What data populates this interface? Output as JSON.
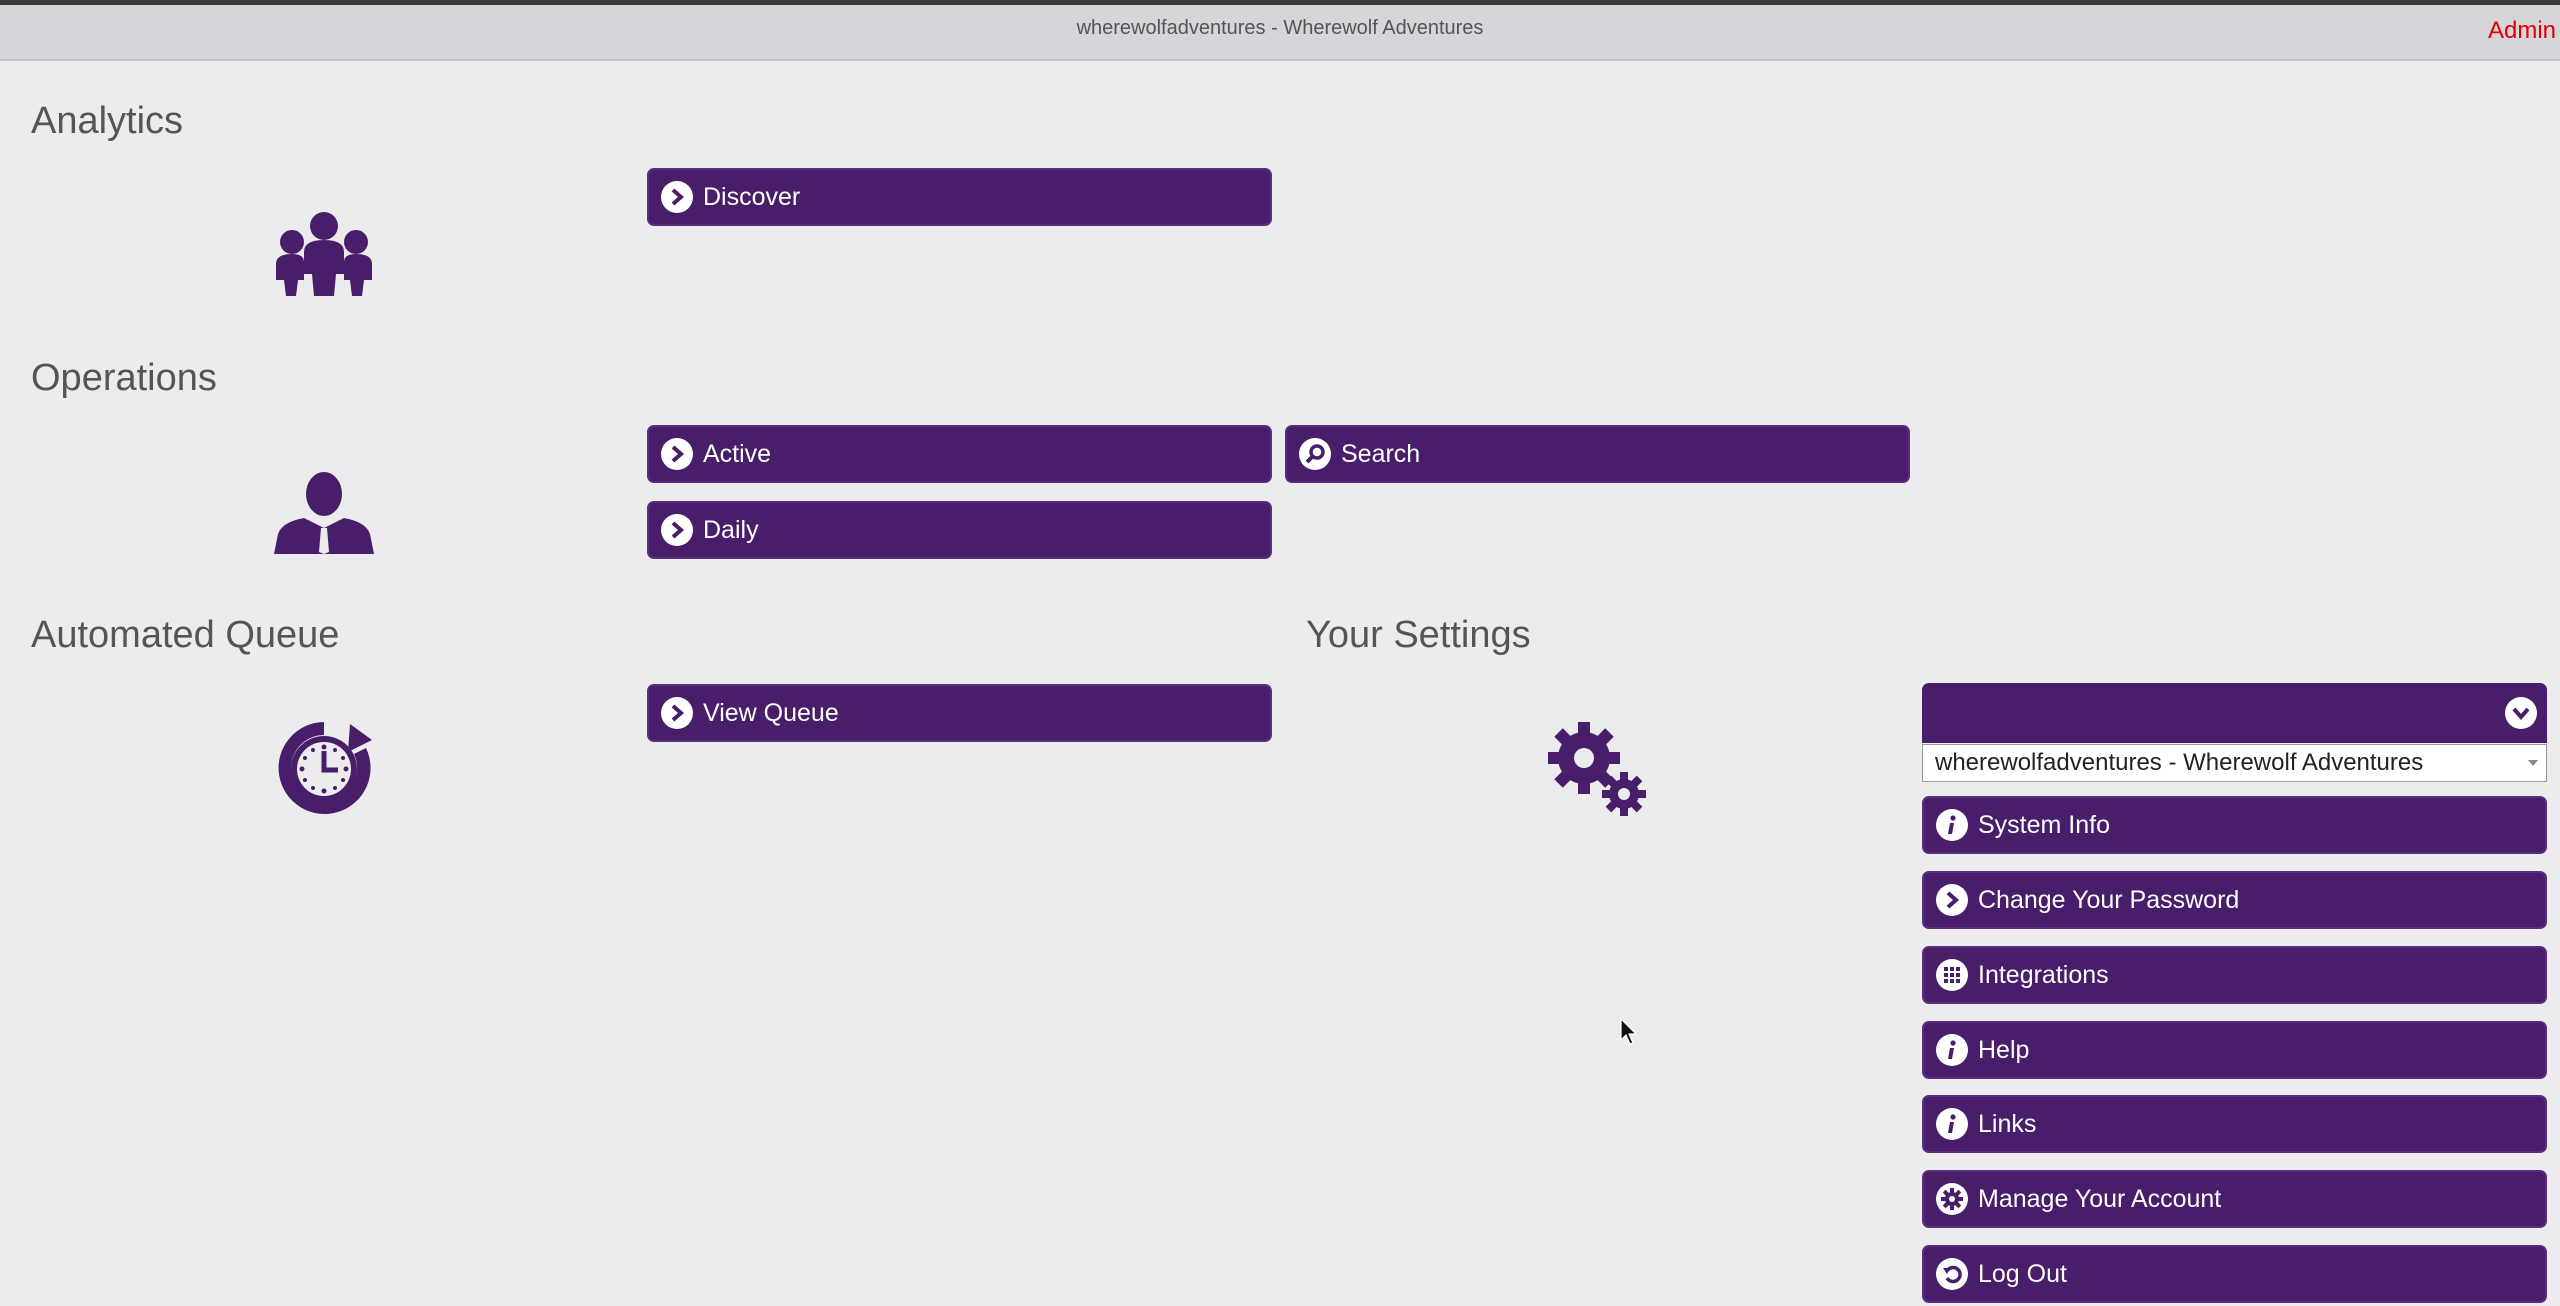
{
  "window": {
    "title": "wherewolfadventures - Wherewolf Adventures",
    "admin_label": "Admin"
  },
  "colors": {
    "button_bg": "#481e6a",
    "page_bg": "#ececef",
    "admin_text": "#e00000"
  },
  "analytics": {
    "heading": "Analytics",
    "icon": "group-icon",
    "buttons": [
      {
        "label": "Discover",
        "icon": "chevron-right-icon"
      }
    ]
  },
  "operations": {
    "heading": "Operations",
    "icon": "person-icon",
    "buttons": [
      {
        "label": "Active",
        "icon": "chevron-right-icon"
      },
      {
        "label": "Search",
        "icon": "search-icon"
      },
      {
        "label": "Daily",
        "icon": "chevron-right-icon"
      }
    ]
  },
  "queue": {
    "heading": "Automated Queue",
    "icon": "clock-icon",
    "buttons": [
      {
        "label": "View Queue",
        "icon": "chevron-right-icon"
      }
    ]
  },
  "settings": {
    "heading": "Your Settings",
    "icon": "gears-icon",
    "account_select": {
      "value": "wherewolfadventures - Wherewolf Adventures"
    },
    "buttons": [
      {
        "label": "System Info",
        "icon": "info-icon"
      },
      {
        "label": "Change Your Password",
        "icon": "chevron-right-icon"
      },
      {
        "label": "Integrations",
        "icon": "grid-icon"
      },
      {
        "label": "Help",
        "icon": "info-icon"
      },
      {
        "label": "Links",
        "icon": "info-icon"
      },
      {
        "label": "Manage Your Account",
        "icon": "gear-icon"
      },
      {
        "label": "Log Out",
        "icon": "logout-icon"
      }
    ]
  }
}
